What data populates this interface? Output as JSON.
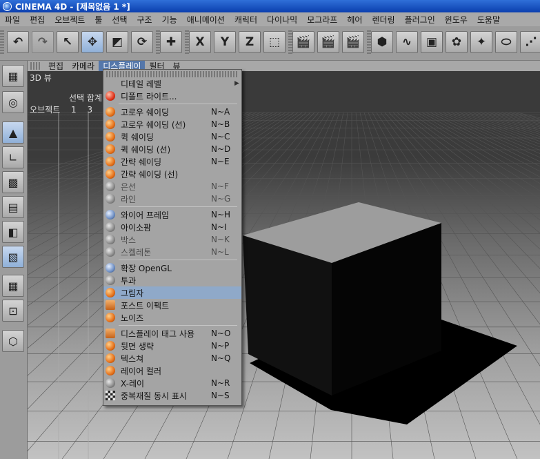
{
  "window": {
    "title": "CINEMA 4D - [제목없음 1 *]"
  },
  "menubar": [
    "파일",
    "편집",
    "오브젝트",
    "툴",
    "선택",
    "구조",
    "기능",
    "애니메이션",
    "캐릭터",
    "다이나믹",
    "모그라프",
    "헤어",
    "렌더링",
    "플러그인",
    "윈도우",
    "도움말"
  ],
  "toolbar": {
    "buttons": [
      {
        "name": "undo-icon",
        "glyph": "↶"
      },
      {
        "name": "redo-icon",
        "glyph": "↷"
      },
      {
        "name": "live-select-icon",
        "glyph": "↖"
      },
      {
        "name": "move-icon",
        "glyph": "✥"
      },
      {
        "name": "scale-icon",
        "glyph": "◩"
      },
      {
        "name": "rotate-icon",
        "glyph": "⟳"
      },
      {
        "name": "world-axis-icon",
        "glyph": "✚"
      },
      {
        "name": "x-axis-lock-icon",
        "glyph": "X"
      },
      {
        "name": "y-axis-lock-icon",
        "glyph": "Y"
      },
      {
        "name": "z-axis-lock-icon",
        "glyph": "Z"
      },
      {
        "name": "coordinate-system-icon",
        "glyph": "⬚"
      },
      {
        "name": "render-view-icon",
        "glyph": "🎬"
      },
      {
        "name": "render-picture-viewer-icon",
        "glyph": "🎬"
      },
      {
        "name": "render-settings-icon",
        "glyph": "🎬"
      },
      {
        "name": "cube-primitive-icon",
        "glyph": "⬢"
      },
      {
        "name": "spline-pen-icon",
        "glyph": "∿"
      },
      {
        "name": "nurbs-icon",
        "glyph": "▣"
      },
      {
        "name": "array-icon",
        "glyph": "✿"
      },
      {
        "name": "deformer-icon",
        "glyph": "✦"
      },
      {
        "name": "scene-object-icon",
        "glyph": "⬭"
      },
      {
        "name": "particle-icon",
        "glyph": "⋰"
      }
    ]
  },
  "lefttoolbar": {
    "buttons": [
      {
        "name": "use-model-mode-icon",
        "glyph": "▦"
      },
      {
        "name": "use-object-mode-icon",
        "glyph": "◎"
      },
      {
        "name": "points-mode-icon",
        "glyph": "▲"
      },
      {
        "name": "edges-mode-icon",
        "glyph": "∟"
      },
      {
        "name": "polygons-mode-icon",
        "glyph": "▩"
      },
      {
        "name": "texture-mode-icon",
        "glyph": "▤"
      },
      {
        "name": "texture-axis-icon",
        "glyph": "◧"
      },
      {
        "name": "animation-mode-icon",
        "glyph": "▧"
      },
      {
        "name": "workplane-icon",
        "glyph": "▦"
      },
      {
        "name": "snap-icon",
        "glyph": "⊡"
      },
      {
        "name": "quantize-icon",
        "glyph": "⬡"
      }
    ]
  },
  "viewport": {
    "menu": [
      "편집",
      "카메라",
      "디스플레이",
      "필터",
      "뷰"
    ],
    "active_menu": "디스플레이",
    "label": "3D 뷰",
    "hud_header": "선택 합계",
    "hud_row": {
      "label": "오브젝트",
      "col1": "1",
      "col2": "3"
    }
  },
  "dropdown": {
    "items": [
      {
        "label": "디테일 레벨",
        "shortcut": "",
        "submenu": true,
        "icon": "",
        "top": 0
      },
      {
        "label": "디폴트 라이트...",
        "shortcut": "",
        "icon": "red"
      },
      {
        "sep": true
      },
      {
        "label": "고로우 쉐이딩",
        "shortcut": "N~A",
        "icon": "orange"
      },
      {
        "label": "고로우 쉐이딩 (선)",
        "shortcut": "N~B",
        "icon": "orange"
      },
      {
        "label": "퀵 쉐이딩",
        "shortcut": "N~C",
        "icon": "orange"
      },
      {
        "label": "퀵 쉐이딩 (선)",
        "shortcut": "N~D",
        "icon": "orange"
      },
      {
        "label": "간략 쉐이딩",
        "shortcut": "N~E",
        "icon": "orange"
      },
      {
        "label": "간략 쉐이딩 (선)",
        "shortcut": "",
        "icon": "orange"
      },
      {
        "label": "은선",
        "shortcut": "N~F",
        "icon": "gray",
        "disabled": true
      },
      {
        "label": "라인",
        "shortcut": "N~G",
        "icon": "gray",
        "disabled": true
      },
      {
        "sep": true
      },
      {
        "label": "와이어 프레임",
        "shortcut": "N~H",
        "icon": "globe"
      },
      {
        "label": "아이소팜",
        "shortcut": "N~I",
        "icon": "gray"
      },
      {
        "label": "박스",
        "shortcut": "N~K",
        "icon": "gray",
        "disabled": true
      },
      {
        "label": "스켈레톤",
        "shortcut": "N~L",
        "icon": "gray",
        "disabled": true
      },
      {
        "sep": true
      },
      {
        "label": "확장 OpenGL",
        "shortcut": "",
        "icon": "globe"
      },
      {
        "label": "투과",
        "shortcut": "",
        "icon": "gray"
      },
      {
        "label": "그림자",
        "shortcut": "",
        "icon": "orange",
        "selected": true
      },
      {
        "label": "포스트 이펙트",
        "shortcut": "",
        "icon": "square"
      },
      {
        "label": "노이즈",
        "shortcut": "",
        "icon": "orange"
      },
      {
        "sep": true
      },
      {
        "label": "디스플레이 태그 사용",
        "shortcut": "N~O",
        "icon": "square"
      },
      {
        "label": "뒷면 생략",
        "shortcut": "N~P",
        "icon": "orange"
      },
      {
        "label": "텍스쳐",
        "shortcut": "N~Q",
        "icon": "orange"
      },
      {
        "label": "레이어 컬러",
        "shortcut": "",
        "icon": "orange"
      },
      {
        "label": "X-레이",
        "shortcut": "N~R",
        "icon": "gray"
      },
      {
        "label": "중복재질 동시 표시",
        "shortcut": "N~S",
        "icon": "check"
      }
    ]
  }
}
